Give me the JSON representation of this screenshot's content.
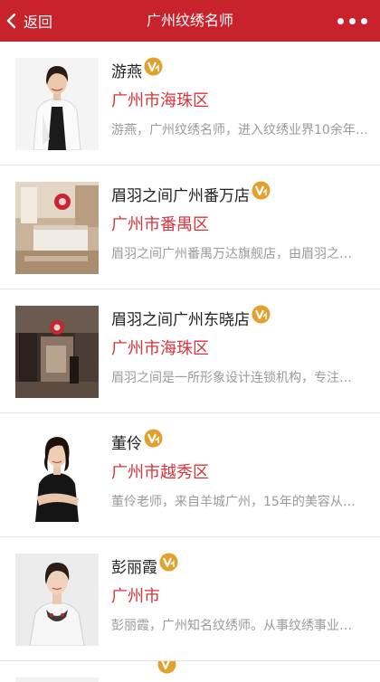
{
  "header": {
    "back_label": "返回",
    "title": "广州纹绣名师"
  },
  "list": [
    {
      "name": "游燕",
      "city": "广州市海珠区",
      "desc": "游燕，广州纹绣名师，进入纹绣业界10余年…",
      "thumb": "woman-in-white-jacket-portrait"
    },
    {
      "name": "眉羽之间广州番万店",
      "city": "广州市番禺区",
      "desc": "眉羽之间广州番禺万达旗舰店，由眉羽之…",
      "thumb": "salon-reception-photo"
    },
    {
      "name": "眉羽之间广州东晓店",
      "city": "广州市海珠区",
      "desc": "眉羽之间是一所形象设计连锁机构，专注…",
      "thumb": "salon-hallway-photo"
    },
    {
      "name": "董伶",
      "city": "广州市越秀区",
      "desc": "董伶老师，来自羊城广州，15年的美容从…",
      "thumb": "woman-in-black-dress-portrait"
    },
    {
      "name": "彭丽霞",
      "city": "广州市",
      "desc": "彭丽霞，广州知名纹绣师。从事纹绣事业…",
      "thumb": "woman-with-necklace-portrait"
    }
  ],
  "colors": {
    "header_bg": "#c8232c",
    "city_text": "#d6343c",
    "badge": "#e1a12c"
  }
}
